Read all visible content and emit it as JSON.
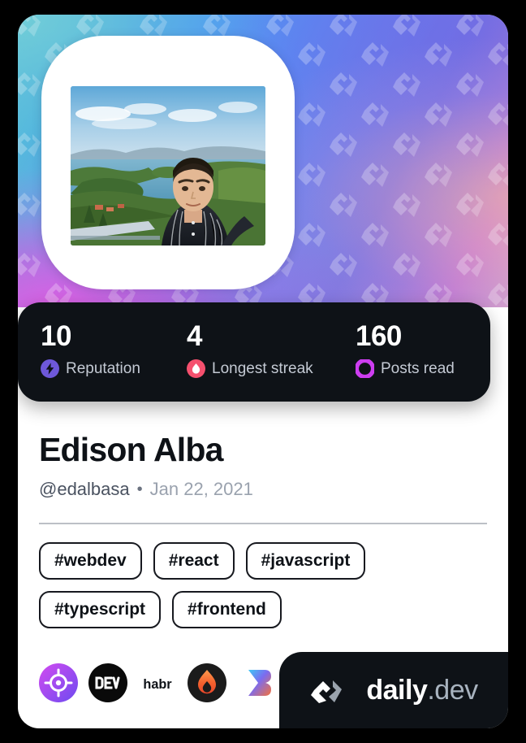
{
  "card": {
    "type": "devcard",
    "background_color": "#000000",
    "card_color": "#ffffff"
  },
  "cover": {
    "gradient_colors": [
      "#5ec8d8",
      "#4f9ef0",
      "#6d7bea",
      "#9f74d8",
      "#e35ce2",
      "#f6c4a0"
    ],
    "watermark_icon": "daily-dev-chevron-pattern"
  },
  "avatar": {
    "alt": "Profile photo of Edison Alba outdoors at a lake overlook",
    "frame_color": "#ffffff"
  },
  "stats": {
    "background_color": "#0e1217",
    "items": [
      {
        "value": "10",
        "label": "Reputation",
        "icon": "bolt-icon",
        "color": "#6e58d9"
      },
      {
        "value": "4",
        "label": "Longest streak",
        "icon": "flame-icon",
        "color": "#f5506e"
      },
      {
        "value": "160",
        "label": "Posts read",
        "icon": "ring-icon",
        "color": "#cd3df0"
      }
    ]
  },
  "profile": {
    "name": "Edison Alba",
    "handle": "@edalbasa",
    "separator": "•",
    "joined": "Jan 22, 2021"
  },
  "tags": [
    "#webdev",
    "#react",
    "#javascript",
    "#typescript",
    "#frontend"
  ],
  "socials": [
    {
      "name": "portfolio-link",
      "icon": "target-icon"
    },
    {
      "name": "devto",
      "icon": "dev-icon",
      "label": "DEV"
    },
    {
      "name": "habr",
      "icon": "habr-icon",
      "label": "habr"
    },
    {
      "name": "hashnode",
      "icon": "flame-circle-icon"
    },
    {
      "name": "bluesky",
      "icon": "b-mark-icon"
    }
  ],
  "footer": {
    "logo": "daily-dev-logo",
    "brand": "daily",
    "brand_suffix": ".dev",
    "background_color": "#0e1217"
  }
}
